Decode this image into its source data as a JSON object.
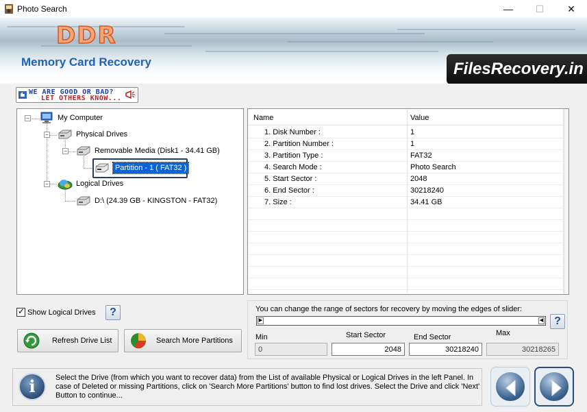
{
  "window": {
    "title": "Photo Search",
    "controls": {
      "minimize": "—",
      "maximize": "☐",
      "close": "✕"
    }
  },
  "banner": {
    "logo": "DDR",
    "product": "Memory Card Recovery",
    "brand": "FilesRecovery.in"
  },
  "feedback": {
    "line1": "WE ARE GOOD OR BAD?",
    "line2": "LET OTHERS KNOW..."
  },
  "tree": {
    "root": "My Computer",
    "physical": "Physical Drives",
    "removable": "Removable Media (Disk1 - 34.41 GB)",
    "partition": "Partition - 1 ( FAT32 )",
    "logical": "Logical Drives",
    "drive_d": "D:\\ (24.39 GB - KINGSTON - FAT32)"
  },
  "properties": {
    "headers": {
      "name": "Name",
      "value": "Value"
    },
    "rows": [
      {
        "name": "1. Disk Number :",
        "value": "1"
      },
      {
        "name": "2. Partition Number :",
        "value": "1"
      },
      {
        "name": "3. Partition Type :",
        "value": "FAT32"
      },
      {
        "name": "4. Search Mode :",
        "value": "Photo Search"
      },
      {
        "name": "5. Start Sector :",
        "value": "2048"
      },
      {
        "name": "6. End Sector :",
        "value": "30218240"
      },
      {
        "name": "7. Size :",
        "value": " 34.41 GB"
      }
    ]
  },
  "controls": {
    "show_logical": "Show Logical Drives",
    "show_logical_checked": true,
    "help": "?",
    "refresh": "Refresh Drive List",
    "search_more": "Search More Partitions"
  },
  "sectors": {
    "hint": "You can change the range of sectors for recovery by moving the edges of slider:",
    "min_label": "Min",
    "min_value": "0",
    "start_label": "Start Sector",
    "start_value": "2048",
    "end_label": "End Sector",
    "end_value": "30218240",
    "max_label": "Max",
    "max_value": "30218265"
  },
  "status": {
    "text": "Select the Drive (from which you want to recover data) from the List of available Physical or Logical Drives in the left Panel. In case of Deleted or missing Partitions, click on 'Search More Partitions' button to find lost drives. Select the Drive and click 'Next' Button to continue...",
    "info_glyph": "i"
  },
  "icons": {
    "app": "camera-icon",
    "computer": "computer-icon",
    "drive": "hard-drive-icon",
    "logical": "logical-drives-icon",
    "refresh": "refresh-icon",
    "pie": "pie-chart-icon",
    "back": "back-arrow-icon",
    "next": "next-arrow-icon"
  },
  "colors": {
    "brand_blue": "#1e63b4",
    "logo_orange": "#f3a77a",
    "selection": "#0a64d8"
  }
}
